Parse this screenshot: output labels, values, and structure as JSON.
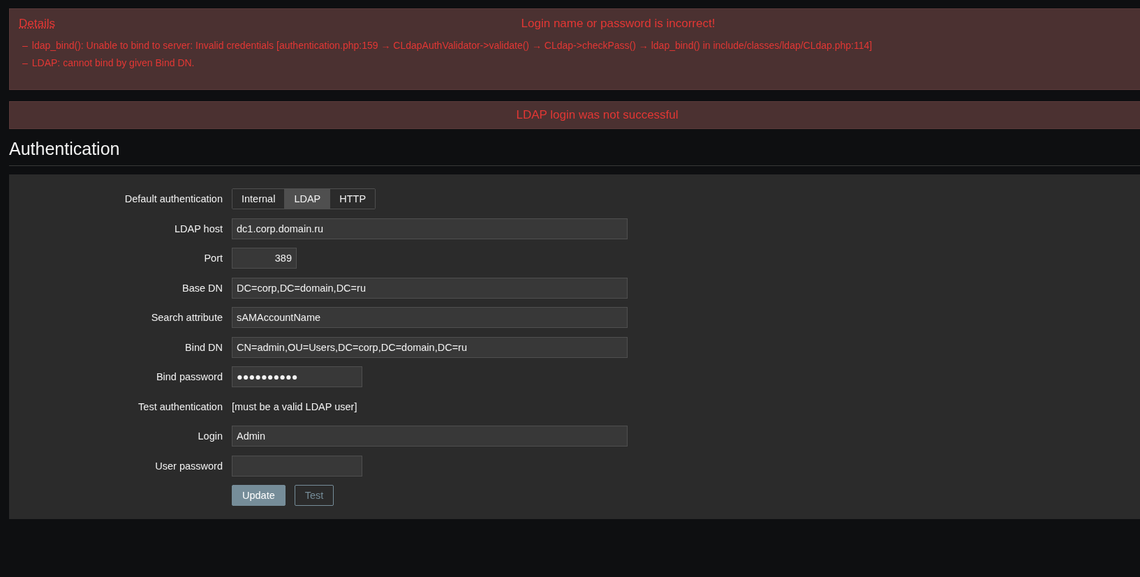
{
  "error_box": {
    "details_link": "Details",
    "title": "Login name or password is incorrect!",
    "messages": [
      {
        "marker": "–",
        "text": "ldap_bind(): Unable to bind to server: Invalid credentials [authentication.php:159 → CLdapAuthValidator->validate() → CLdap->checkPass() → ldap_bind() in include/classes/ldap/CLdap.php:114]"
      },
      {
        "marker": "–",
        "text": "LDAP: cannot bind by given Bind DN."
      }
    ]
  },
  "error_banner": {
    "title": "LDAP login was not successful"
  },
  "page_title": "Authentication",
  "form": {
    "rows": [
      {
        "kind": "segmented",
        "label": "Default authentication",
        "options": [
          {
            "label": "Internal",
            "selected": false
          },
          {
            "label": "LDAP",
            "selected": true
          },
          {
            "label": "HTTP",
            "selected": false
          }
        ]
      },
      {
        "kind": "text",
        "label": "LDAP host",
        "value": "dc1.corp.domain.ru"
      },
      {
        "kind": "number",
        "label": "Port",
        "value": "389"
      },
      {
        "kind": "text",
        "label": "Base DN",
        "value": "DC=corp,DC=domain,DC=ru"
      },
      {
        "kind": "text",
        "label": "Search attribute",
        "value": "sAMAccountName"
      },
      {
        "kind": "text",
        "label": "Bind DN",
        "value": "CN=admin,OU=Users,DC=corp,DC=domain,DC=ru"
      },
      {
        "kind": "password",
        "label": "Bind password",
        "value": "●●●●●●●●●●"
      },
      {
        "kind": "note",
        "label": "Test authentication",
        "value": "[must be a valid LDAP user]"
      },
      {
        "kind": "text",
        "label": "Login",
        "value": "Admin"
      },
      {
        "kind": "password",
        "label": "User password"
      }
    ],
    "buttons": [
      {
        "label": "Update",
        "disabled": false
      },
      {
        "label": "Test",
        "disabled": true
      }
    ]
  }
}
